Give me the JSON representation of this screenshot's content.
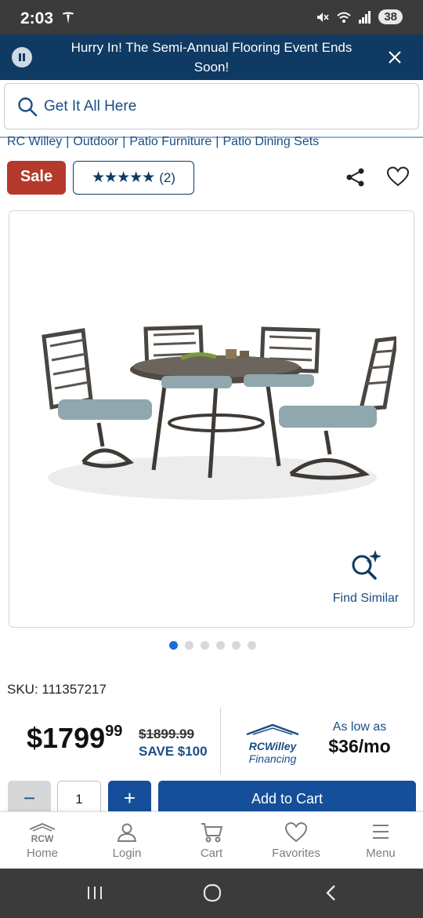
{
  "status": {
    "time": "2:03",
    "battery": "38"
  },
  "banner": {
    "message": "Hurry In! The Semi-Annual Flooring Event Ends Soon!"
  },
  "search": {
    "placeholder": "Get It All Here"
  },
  "breadcrumbs": [
    "RC Willey",
    "Outdoor",
    "Patio Furniture",
    "Patio Dining Sets"
  ],
  "product": {
    "badge": "Sale",
    "rating_stars": "★★★★★",
    "rating_count": "(2)",
    "find_similar": "Find Similar",
    "sku": "SKU: 111357217",
    "price_dollars": "$1799",
    "price_cents": "99",
    "was_price": "$1899.99",
    "savings": "SAVE $100",
    "financing_brand": "RCWilley",
    "financing_label": "Financing",
    "as_low_as": "As low as",
    "monthly": "$36/mo",
    "image_count": 6,
    "active_image": 1
  },
  "cart": {
    "minus": "−",
    "quantity": "1",
    "plus": "+",
    "add_label": "Add to Cart"
  },
  "tabs": [
    {
      "label": "Home",
      "icon": "rcw-home-icon"
    },
    {
      "label": "Login",
      "icon": "person-icon"
    },
    {
      "label": "Cart",
      "icon": "cart-icon"
    },
    {
      "label": "Favorites",
      "icon": "heart-icon"
    },
    {
      "label": "Menu",
      "icon": "hamburger-icon"
    }
  ],
  "tab_logo_text": "RCW",
  "colors": {
    "brand_navy": "#0f3a63",
    "sale_red": "#b53a2c",
    "button_blue": "#154e9a",
    "link_blue": "#1a4f86"
  }
}
